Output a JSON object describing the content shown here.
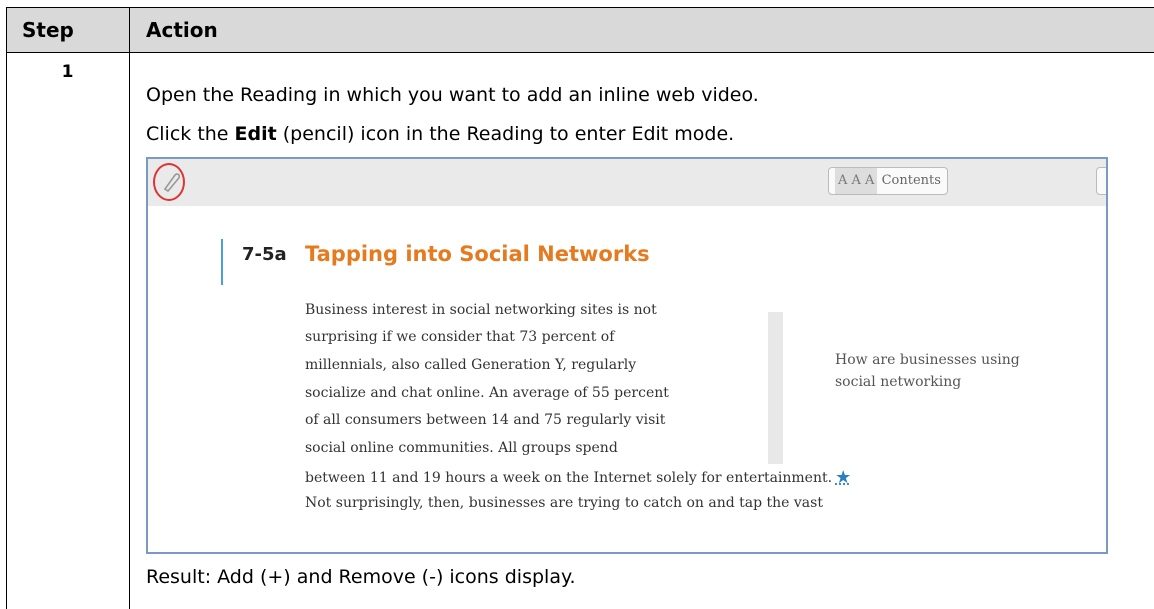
{
  "table": {
    "header_step": "Step",
    "header_action": "Action",
    "step_number": "1",
    "line1": "Open the Reading in which you want to add an inline web video.",
    "line2_prefix": "Click the ",
    "line2_bold": "Edit",
    "line2_suffix": " (pencil) icon in the Reading to enter Edit mode.",
    "result": "Result: Add (+) and Remove (-) icons display."
  },
  "screenshot": {
    "toolbar_text_button": "Contents",
    "toolbar_text_size_glyphs": "A A A",
    "section_number": "7-5a",
    "section_title": "Tapping into Social Networks",
    "paragraph_lines": [
      "Business interest in social networking sites is not",
      "surprising if we consider that 73 percent of",
      "millennials, also called Generation Y, regularly",
      "socialize and chat online. An average of 55 percent",
      "of all consumers between 14 and 75 regularly visit",
      "social online communities. All groups spend",
      "between 11 and 19 hours a week on the Internet solely for entertainment.",
      "Not surprisingly, then, businesses are trying to catch on and tap the vast"
    ],
    "sidebar_question": "How are businesses using social networking",
    "star_glyph": "★"
  },
  "colors": {
    "header_bg": "#d9d9d9",
    "title_orange": "#e57a1f",
    "accent_blue": "#4aa0d8",
    "highlight_red": "#d33333"
  }
}
